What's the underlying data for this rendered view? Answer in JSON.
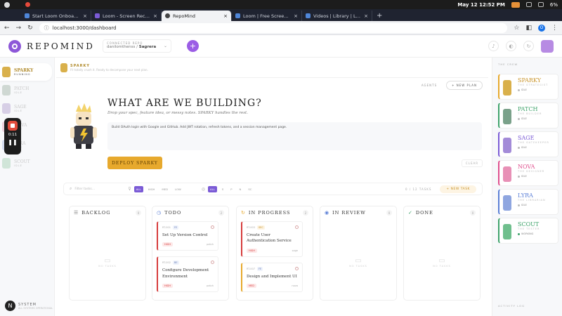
{
  "system_bar": {
    "datetime": "May 12  12:52 PM",
    "battery": "6%"
  },
  "browser": {
    "tabs": [
      {
        "title": "Start Loom Onboarding",
        "active": false
      },
      {
        "title": "Loom - Screen Recording",
        "active": false
      },
      {
        "title": "RepoMind",
        "active": true
      },
      {
        "title": "Loom | Free Screen & Video",
        "active": false
      },
      {
        "title": "Videos | Library | Loom",
        "active": false
      }
    ],
    "url": "localhost:3000/dashboard",
    "profile_initial": "O"
  },
  "header": {
    "brand": "REPOMIND",
    "repo_label": "CONNECTED REPO",
    "repo_owner": "danilomthenss /",
    "repo_name": "Sagrera"
  },
  "left_sidebar": {
    "agents": [
      {
        "name": "SPARKY",
        "sub": "RUNNING",
        "active": true
      },
      {
        "name": "PATCH",
        "sub": "IDLE"
      },
      {
        "name": "SAGE",
        "sub": "IDLE"
      },
      {
        "name": "NOVA",
        "sub": "IDLE"
      },
      {
        "name": "LYRA",
        "sub": "IDLE"
      },
      {
        "name": "SCOUT",
        "sub": "IDLE"
      }
    ],
    "system": {
      "label": "SYSTEM",
      "sub": "ALL SYSTEMS OPERATIONAL",
      "initial": "N"
    }
  },
  "loom": {
    "time": "0:11"
  },
  "sub_bar": {
    "name": "SPARKY",
    "status": "I'll totally crush it. Ready to decompose your next plan."
  },
  "hero": {
    "agents_label": "AGENTS",
    "new_plan_label": "+ NEW PLAN",
    "title": "WHAT ARE WE BUILDING?",
    "subtitle": "Drop your spec, feature idea, or messy notes. SPARKY handles the rest.",
    "input_text": "Build OAuth login with Google and GitHub. Add JWT rotation, refresh tokens, and a session management page.",
    "deploy_label": "DEPLOY SPARKY",
    "clear_label": "CLEAR"
  },
  "filters": {
    "search_placeholder": "Filter tasks...",
    "priority_chips": [
      "ALL",
      "HIGH",
      "MED",
      "LOW"
    ],
    "assignee_chips": [
      "ALL",
      "S",
      "P",
      "N",
      "SC"
    ],
    "count_label": "0 / 12 TASKS",
    "new_task_label": "+ NEW TASK"
  },
  "columns": [
    {
      "title": "BACKLOG",
      "count": "0",
      "empty": "NO TASKS"
    },
    {
      "title": "TODO",
      "count": "2",
      "cards": [
        {
          "id": "RT-001",
          "tag": "FE",
          "title": "Set Up Version Control",
          "priority": "HIGH",
          "assignee": "patch"
        },
        {
          "id": "RT-002",
          "tag": "BE",
          "title": "Configure Development Environment",
          "priority": "HIGH",
          "assignee": "patch"
        }
      ]
    },
    {
      "title": "IN PROGRESS",
      "count": "2",
      "cards": [
        {
          "id": "RT-003",
          "tag": "SEC",
          "title": "Create User Authentication Service",
          "priority": "HIGH",
          "assignee": "sage",
          "color": "red"
        },
        {
          "id": "RT-007",
          "tag": "FE",
          "title": "Design and Implement UI",
          "priority": "MED",
          "assignee": "nova",
          "color": "yellow"
        }
      ]
    },
    {
      "title": "IN REVIEW",
      "count": "0",
      "empty": "NO TASKS"
    },
    {
      "title": "DONE",
      "count": "0",
      "empty": "NO TASKS"
    }
  ],
  "crew": {
    "title": "THE CREW",
    "members": [
      {
        "name": "SPARKY",
        "role": "THE STRATEGIST",
        "status": "IDLE",
        "color": "#e7a92d"
      },
      {
        "name": "PATCH",
        "role": "THE BUILDER",
        "status": "IDLE",
        "color": "#3fa36b"
      },
      {
        "name": "SAGE",
        "role": "THE GATEKEEPER",
        "status": "IDLE",
        "color": "#7b5bd6"
      },
      {
        "name": "NOVA",
        "role": "THE DESIGNER",
        "status": "IDLE",
        "color": "#e0508e"
      },
      {
        "name": "LYRA",
        "role": "THE LIBRARIAN",
        "status": "IDLE",
        "color": "#5b7fd6"
      },
      {
        "name": "SCOUT",
        "role": "THE TESTER",
        "status": "WORKING",
        "color": "#3fa36b"
      }
    ],
    "activity_title": "ACTIVITY LOG"
  }
}
